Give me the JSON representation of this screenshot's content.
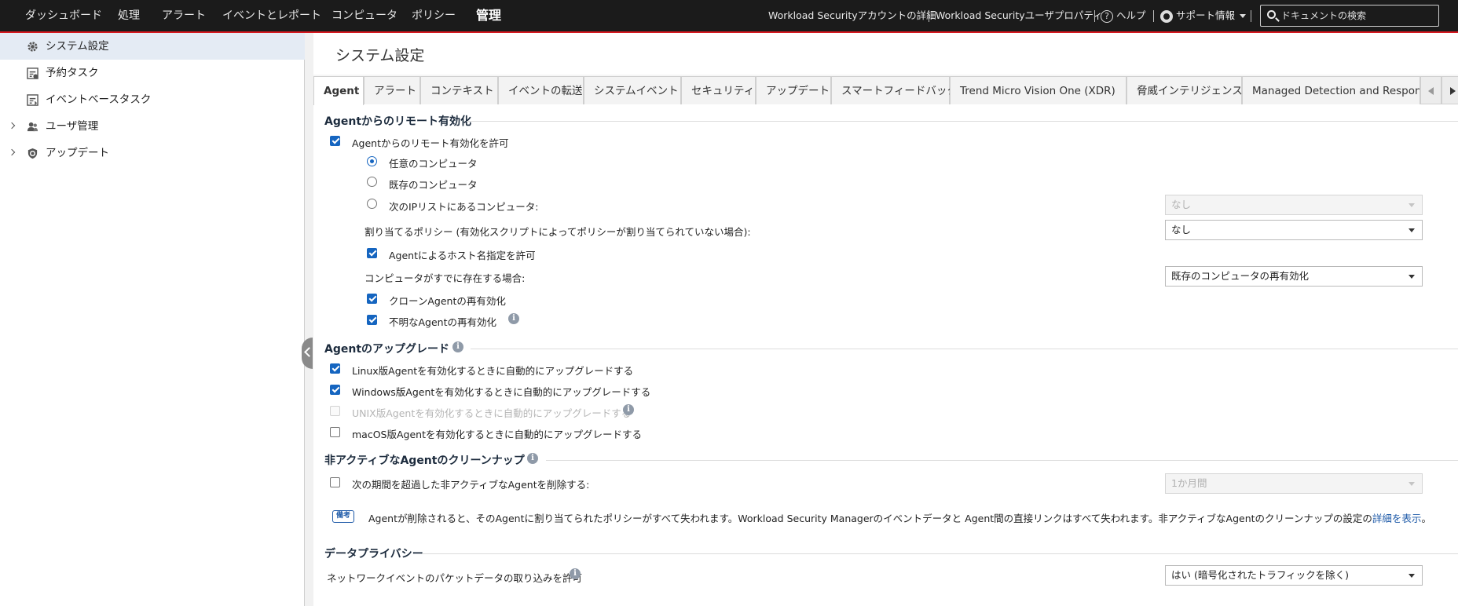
{
  "topnav": {
    "items": [
      "ダッシュボード",
      "処理",
      "アラート",
      "イベントとレポート",
      "コンピュータ",
      "ポリシー",
      "管理"
    ],
    "active": "管理",
    "account_details": "Workload Securityアカウントの詳細",
    "user_properties": "Workload Securityユーザプロパティ",
    "help_icon_glyph": "?",
    "help": "ヘルプ",
    "support": "サポート情報",
    "search_placeholder": "ドキュメントの検索"
  },
  "sidebar": {
    "items": [
      {
        "label": "システム設定",
        "icon": "gear-icon"
      },
      {
        "label": "予約タスク",
        "icon": "scheduled-task-icon"
      },
      {
        "label": "イベントベースタスク",
        "icon": "event-task-icon"
      },
      {
        "label": "ユーザ管理",
        "icon": "users-icon"
      },
      {
        "label": "アップデート",
        "icon": "update-shield-icon"
      }
    ]
  },
  "page": {
    "title": "システム設定",
    "tabs": [
      "Agent",
      "アラート",
      "コンテキスト",
      "イベントの転送",
      "システムイベント",
      "セキュリティ",
      "アップデート",
      "スマートフィードバック",
      "Trend Micro Vision One (XDR)",
      "脅威インテリジェンス",
      "Managed Detection and Response"
    ],
    "active_tab": "Agent"
  },
  "remote": {
    "title": "Agentからのリモート有効化",
    "allow": "Agentからのリモート有効化を許可",
    "any": "任意のコンピュータ",
    "existing": "既存のコンピュータ",
    "iplist": "次のIPリストにあるコンピュータ:",
    "iplist_value": "なし",
    "policy_label": "割り当てるポリシー (有効化スクリプトによってポリシーが割り当てられていない場合):",
    "policy_value": "なし",
    "hostname": "Agentによるホスト名指定を許可",
    "exists_label": "コンピュータがすでに存在する場合:",
    "exists_value": "既存のコンピュータの再有効化",
    "clone": "クローンAgentの再有効化",
    "unknown": "不明なAgentの再有効化",
    "info_glyph": "i"
  },
  "upgrade": {
    "title": "Agentのアップグレード",
    "linux": "Linux版Agentを有効化するときに自動的にアップグレードする",
    "windows": "Windows版Agentを有効化するときに自動的にアップグレードする",
    "unix": "UNIX版Agentを有効化するときに自動的にアップグレードする",
    "macos": "macOS版Agentを有効化するときに自動的にアップグレードする"
  },
  "cleanup": {
    "title": "非アクティブなAgentのクリーンナップ",
    "delete": "次の期間を超過した非アクティブなAgentを削除する:",
    "period_value": "1か月間",
    "note_badge": "備考",
    "note": "Agentが削除されると、そのAgentに割り当てられたポリシーがすべて失われます。Workload Security Managerのイベントデータと Agent間の直接リンクはすべて失われます。非アクティブなAgentのクリーンナップの設定の",
    "note_link": "詳細を表示",
    "note_end": "。"
  },
  "privacy": {
    "title": "データプライバシー",
    "packet": "ネットワークイベントのパケットデータの取り込みを許可",
    "packet_value": "はい (暗号化されたトラフィックを除く)"
  }
}
